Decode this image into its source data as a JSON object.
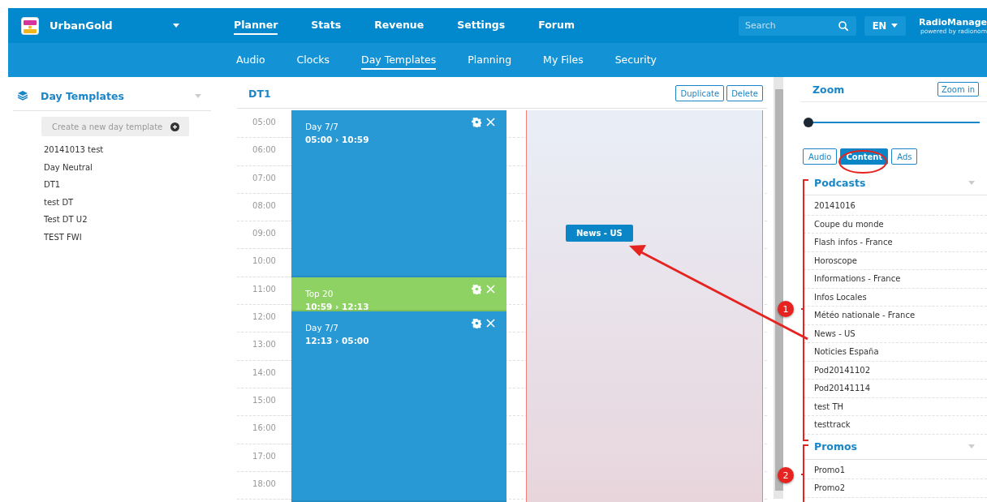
{
  "header": {
    "station": "UrbanGold",
    "nav": [
      {
        "label": "Planner",
        "selected": true
      },
      {
        "label": "Stats",
        "selected": false
      },
      {
        "label": "Revenue",
        "selected": false
      },
      {
        "label": "Settings",
        "selected": false
      },
      {
        "label": "Forum",
        "selected": false
      }
    ],
    "search": {
      "placeholder": "Search"
    },
    "language": "EN",
    "brand": {
      "name": "RadioManage",
      "tagline": "powered by radionom"
    }
  },
  "subnav": [
    {
      "label": "Audio",
      "selected": false
    },
    {
      "label": "Clocks",
      "selected": false
    },
    {
      "label": "Day Templates",
      "selected": true
    },
    {
      "label": "Planning",
      "selected": false
    },
    {
      "label": "My Files",
      "selected": false
    },
    {
      "label": "Security",
      "selected": false
    }
  ],
  "sidebar": {
    "title": "Day Templates",
    "create_button": "Create a new day template",
    "items": [
      "20141013 test",
      "Day Neutral",
      "DT1",
      "test DT",
      "Test DT U2",
      "TEST FWI"
    ]
  },
  "calendar": {
    "title": "DT1",
    "buttons": [
      "Duplicate",
      "Delete"
    ],
    "hours": [
      "05:00",
      "06:00",
      "07:00",
      "08:00",
      "09:00",
      "10:00",
      "11:00",
      "12:00",
      "13:00",
      "14:00",
      "15:00",
      "16:00",
      "17:00",
      "18:00"
    ],
    "blocks": [
      {
        "name": "Day 7/7",
        "time": "05:00 › 10:59",
        "color": "#2899d5"
      },
      {
        "name": "Top 20",
        "time": "10:59 › 12:13",
        "color": "#8dd263"
      },
      {
        "name": "Day 7/7",
        "time": "12:13 › 05:00",
        "color": "#2899d5"
      }
    ],
    "dropped": {
      "label": "News - US"
    }
  },
  "panel": {
    "zoom": {
      "title": "Zoom",
      "button": "Zoom in",
      "level": 0
    },
    "tabs": [
      {
        "label": "Audio",
        "selected": false
      },
      {
        "label": "Content",
        "selected": true
      },
      {
        "label": "Ads",
        "selected": false
      }
    ],
    "sections": [
      {
        "title": "Podcasts",
        "items": [
          "20141016",
          "Coupe du monde",
          "Flash infos - France",
          "Horoscope",
          "Informations - France",
          "Infos Locales",
          "Météo nationale - France",
          "News - US",
          "Noticies España",
          "Pod20141102",
          "Pod20141114",
          "test TH",
          "testtrack"
        ]
      },
      {
        "title": "Promos",
        "items": [
          "Promo1",
          "Promo2"
        ]
      }
    ]
  },
  "annotations": {
    "markers": [
      "1",
      "2"
    ]
  }
}
